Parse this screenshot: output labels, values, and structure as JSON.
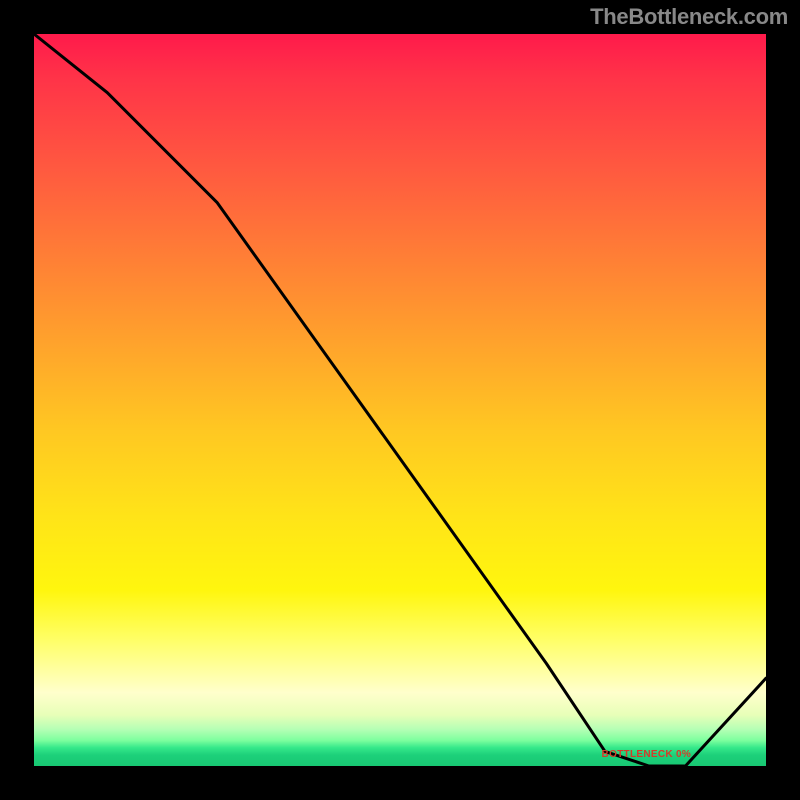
{
  "attribution": "TheBottleneck.com",
  "chart_data": {
    "type": "line",
    "title": "",
    "xlabel": "",
    "ylabel": "",
    "xlim": [
      0,
      100
    ],
    "ylim": [
      0,
      100
    ],
    "x": [
      0,
      10,
      20,
      25,
      40,
      55,
      70,
      78,
      84,
      89,
      100
    ],
    "values": [
      100,
      92,
      82,
      77,
      56,
      35,
      14,
      2,
      0,
      0,
      12
    ],
    "notch": {
      "x_start": 78,
      "x_end": 89,
      "y": 0
    }
  },
  "annotation": {
    "text": "BOTTLENECK 0%",
    "x_percent": 83
  },
  "colors": {
    "line": "#000000",
    "annotation": "#d43c2a",
    "attribution": "#888888"
  }
}
